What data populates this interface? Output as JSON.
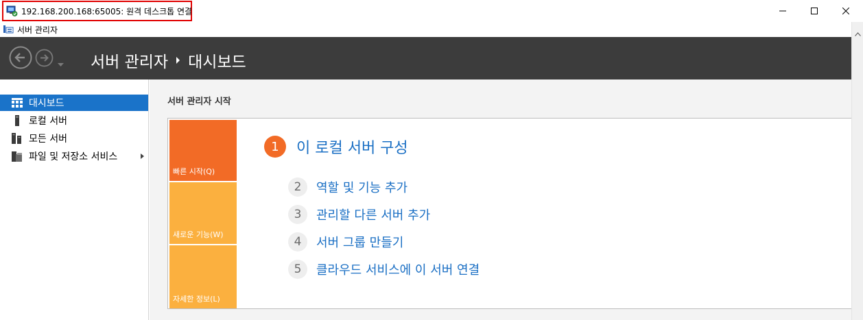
{
  "window": {
    "title": "192.168.200.168:65005: 원격 데스크톱 연결",
    "icon": "remote-desktop-icon"
  },
  "app": {
    "title": "서버 관리자",
    "icon": "server-manager-icon"
  },
  "header": {
    "breadcrumb": [
      "서버 관리자",
      "대시보드"
    ]
  },
  "sidebar": {
    "items": [
      {
        "label": "대시보드",
        "icon": "dashboard-icon",
        "active": true
      },
      {
        "label": "로컬 서버",
        "icon": "local-server-icon",
        "active": false
      },
      {
        "label": "모든 서버",
        "icon": "all-servers-icon",
        "active": false
      },
      {
        "label": "파일 및 저장소 서비스",
        "icon": "file-storage-icon",
        "active": false,
        "expandable": true
      }
    ]
  },
  "main": {
    "section_title": "서버 관리자 시작",
    "tiles": [
      {
        "label": "빠른 시작(Q)",
        "color": "#f26b26"
      },
      {
        "label": "새로운 기능(W)",
        "color": "#fbb03f"
      },
      {
        "label": "자세한 정보(L)",
        "color": "#fbb03f"
      }
    ],
    "primary_step": {
      "number": "1",
      "label": "이 로컬 서버 구성"
    },
    "steps": [
      {
        "number": "2",
        "label": "역할 및 기능 추가"
      },
      {
        "number": "3",
        "label": "관리할 다른 서버 추가"
      },
      {
        "number": "4",
        "label": "서버 그룹 만들기"
      },
      {
        "number": "5",
        "label": "클라우드 서비스에 이 서버 연결"
      }
    ]
  },
  "colors": {
    "accent": "#1a6fc4",
    "active_nav": "#1a73c9",
    "header_bg": "#3c3c3c",
    "tile_orange": "#f26b26",
    "tile_yellow": "#fbb03f"
  }
}
